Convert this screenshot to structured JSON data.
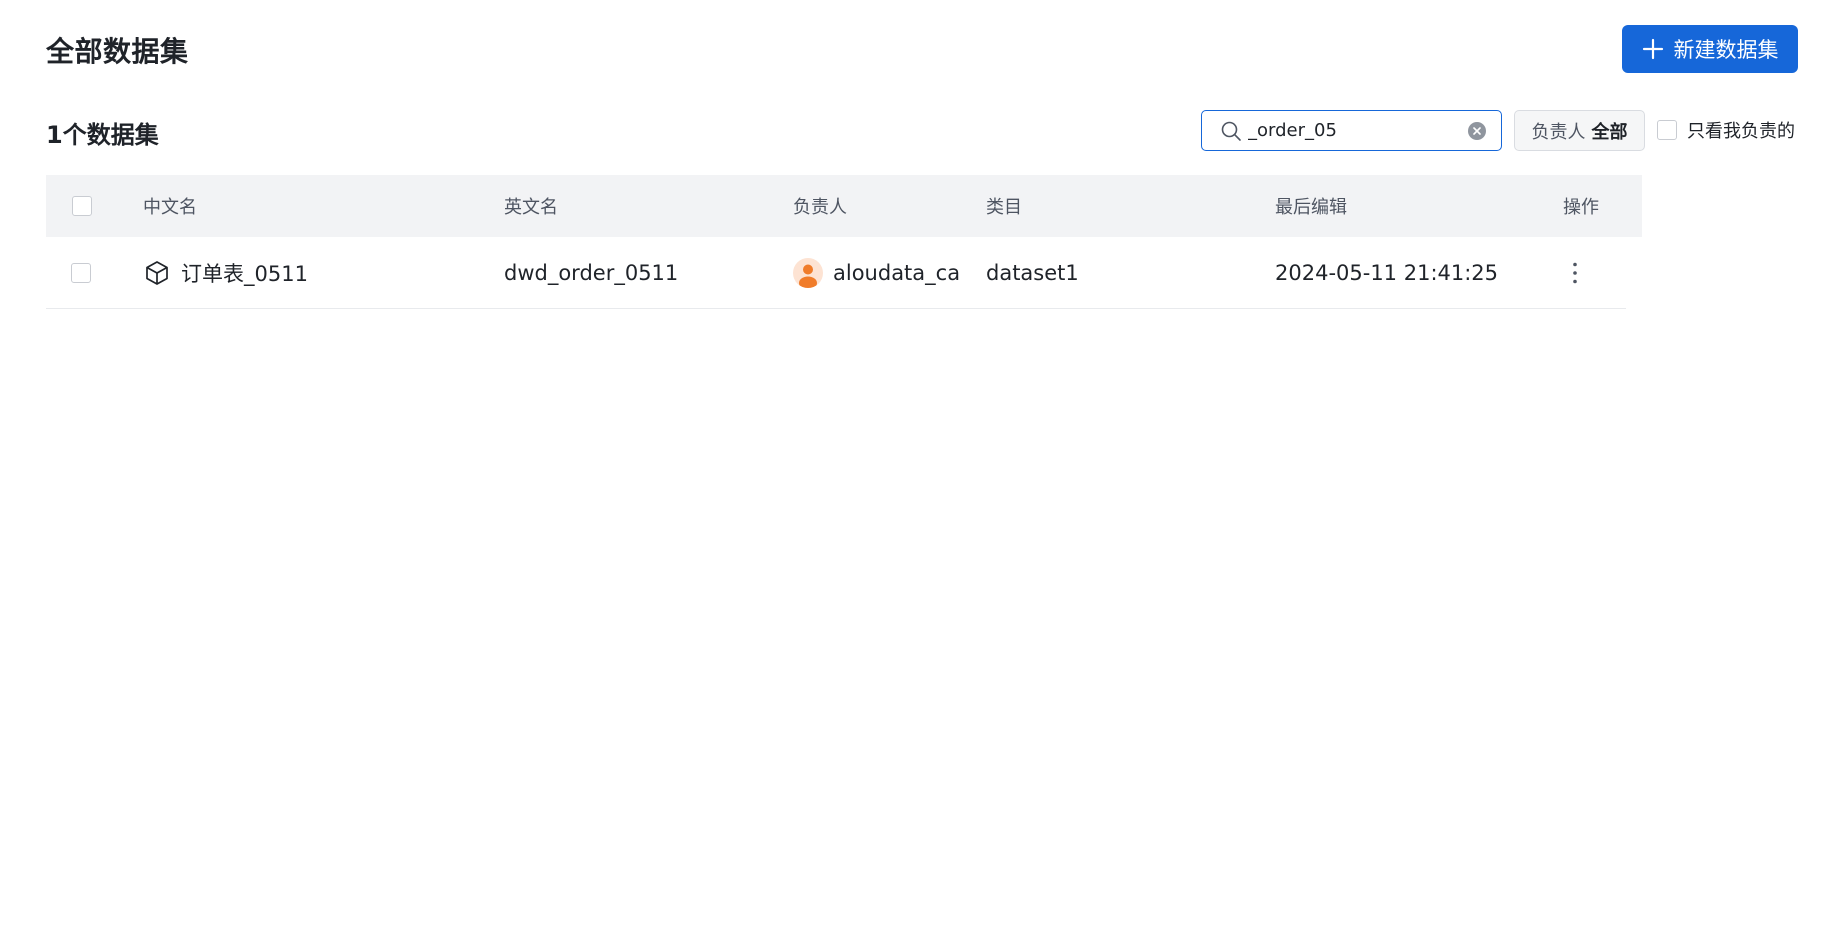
{
  "header": {
    "title": "全部数据集",
    "new_button_label": "新建数据集"
  },
  "toolbar": {
    "count_label": "1个数据集",
    "search": {
      "value": "_order_05",
      "placeholder": ""
    },
    "owner_filter": {
      "label": "负责人",
      "value": "全部"
    },
    "mine_only_label": "只看我负责的"
  },
  "table": {
    "columns": {
      "cn_name": "中文名",
      "en_name": "英文名",
      "owner": "负责人",
      "category": "类目",
      "last_edit": "最后编辑",
      "actions": "操作"
    },
    "rows": [
      {
        "cn_name": "订单表_0511",
        "en_name": "dwd_order_0511",
        "owner": "aloudata_can",
        "category": "dataset1",
        "last_edit": "2024-05-11 21:41:25",
        "icon": "cube-icon"
      }
    ]
  },
  "colors": {
    "primary": "#1667d9",
    "header_bg": "#f2f3f5",
    "avatar_accent": "#f07c2a"
  }
}
